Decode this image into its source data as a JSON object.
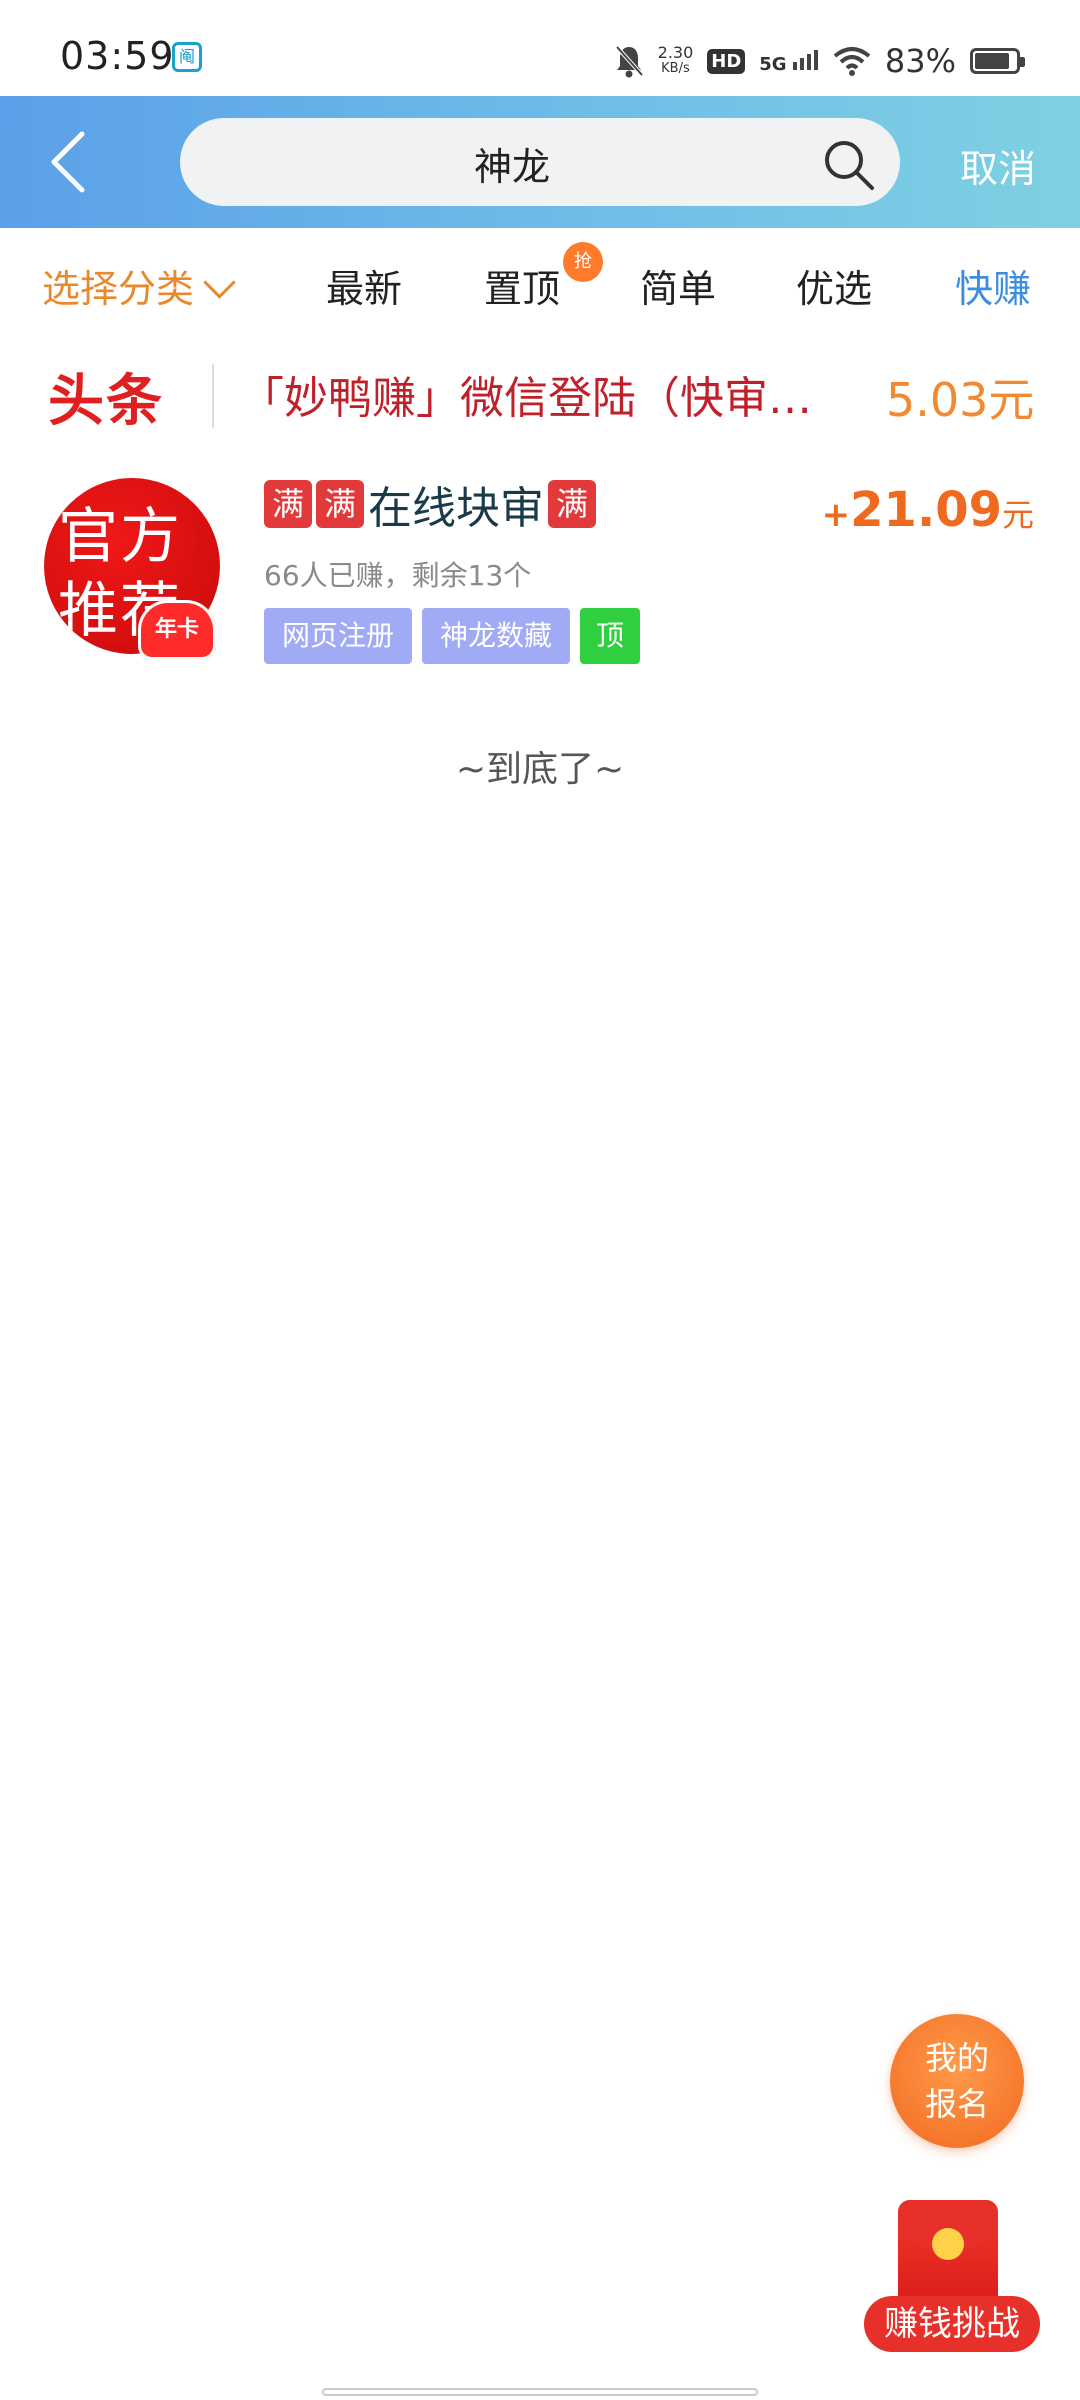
{
  "status_bar": {
    "time": "03:59",
    "app_icon": "阄",
    "net_speed_value": "2.30",
    "net_speed_unit": "KB/s",
    "hd": "HD",
    "network": "5G",
    "battery": "83%"
  },
  "header": {
    "search_value": "神龙",
    "cancel_label": "取消"
  },
  "tabs": {
    "category": "选择分类",
    "newest": "最新",
    "pinned": "置顶",
    "pinned_badge": "抢",
    "simple": "简单",
    "featured": "优选",
    "fast": "快赚"
  },
  "headline": {
    "logo": "头条",
    "text": "「妙鸭赚」微信登陆（快审…",
    "amount": "5.03元"
  },
  "task": {
    "avatar_line1": "官方",
    "avatar_line2": "推荐",
    "year_card": "年卡",
    "badge": "满",
    "title_text": "在线块审",
    "meta": "66人已赚，剩余13个",
    "tags": [
      "网页注册",
      "神龙数藏",
      "顶"
    ],
    "reward_plus": "+",
    "reward_value": "21.09",
    "reward_unit": "元"
  },
  "end_text": "~到底了~",
  "floating": {
    "signup_line1": "我的",
    "signup_line2": "报名",
    "challenge_label": "赚钱挑战"
  },
  "colors": {
    "header_gradient_start": "#5aa0e8",
    "header_gradient_end": "#7ed1e2",
    "accent_orange": "#e8892e",
    "accent_blue": "#3b8de0",
    "headline_red": "#c0202a",
    "reward_orange": "#ef6a1e",
    "tag_purple": "#a0aaf5",
    "tag_green": "#2fcf3f"
  }
}
